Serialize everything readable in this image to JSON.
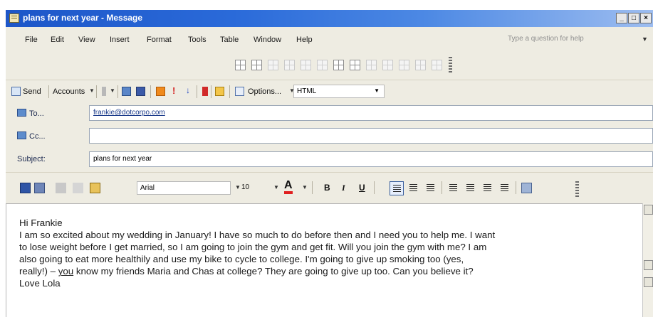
{
  "window": {
    "title": "plans for next year - Message",
    "controls": [
      "_",
      "□",
      "×"
    ]
  },
  "menu": {
    "items": [
      "File",
      "Edit",
      "View",
      "Insert",
      "Format",
      "Tools",
      "Table",
      "Window",
      "Help"
    ],
    "help_placeholder": "Type a question for help"
  },
  "send_toolbar": {
    "send_label": "Send",
    "accounts_label": "Accounts",
    "importance_high": "!",
    "importance_low": "↓",
    "options_label": "Options...",
    "format_value": "HTML"
  },
  "headers": {
    "to_label": "To...",
    "to_value": "frankie@dotcorpo.com",
    "cc_label": "Cc...",
    "cc_value": "",
    "subject_label": "Subject:",
    "subject_value": "plans for next year"
  },
  "format_toolbar": {
    "font_value": "Arial",
    "size_value": "10",
    "font_color_glyph": "A",
    "bold_glyph": "B",
    "italic_glyph": "I",
    "underline_glyph": "U"
  },
  "message": {
    "lines": [
      "Hi Frankie",
      "I am so excited about my wedding in January! I have so much to do before then and I need you to help me. I want",
      "to lose weight before I get married, so I am going to join the gym and get fit. Will you join the gym with me? I am",
      "also going to eat more healthily and use my bike to cycle to college. I'm going to give up smoking too (yes,"
    ],
    "line5_a": "really!) – ",
    "line5_u": "you",
    "line5_b": " know my friends Maria and Chas at college? They are going to give up too. Can you believe it?",
    "signoff": "Love Lola"
  },
  "colors": {
    "title_bar": "#2a6ad9",
    "toolbar_bg": "#eeece2",
    "link": "#1a3a8a"
  }
}
